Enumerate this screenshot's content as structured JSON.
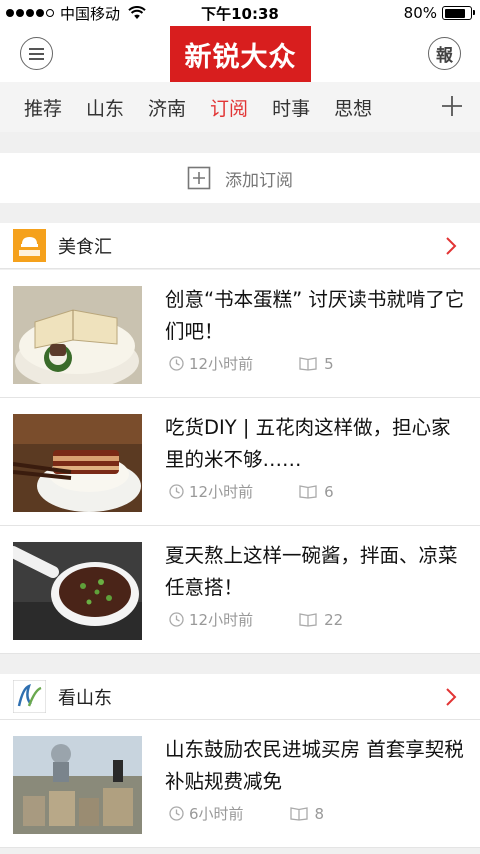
{
  "status_bar": {
    "carrier": "中国移动",
    "time": "下午10:38",
    "battery": "80%",
    "battery_level": 0.8
  },
  "header": {
    "logo_text": "新锐大众",
    "paper_button": "報",
    "colors": {
      "brand": "#d81e1e"
    }
  },
  "tabs": [
    {
      "label": "推荐"
    },
    {
      "label": "山东"
    },
    {
      "label": "济南"
    },
    {
      "label": "订阅",
      "active": true
    },
    {
      "label": "时事"
    },
    {
      "label": "思想"
    }
  ],
  "add_subscription": {
    "label": "添加订阅"
  },
  "sections": [
    {
      "title": "美食汇",
      "articles": [
        {
          "headline": "创意“书本蛋糕” 讨厌读书就啃了它们吧！",
          "time": "12小时前",
          "reads": "5"
        },
        {
          "headline": "吃货DIY | 五花肉这样做，担心家里的米不够……",
          "time": "12小时前",
          "reads": "6"
        },
        {
          "headline": "夏天熬上这样一碗酱，拌面、凉菜任意搭！",
          "time": "12小时前",
          "reads": "22"
        }
      ]
    },
    {
      "title": "看山东",
      "articles": [
        {
          "headline": "山东鼓励农民进城买房 首套享契税补贴规费减免",
          "time": "6小时前",
          "reads": "8"
        }
      ]
    }
  ]
}
